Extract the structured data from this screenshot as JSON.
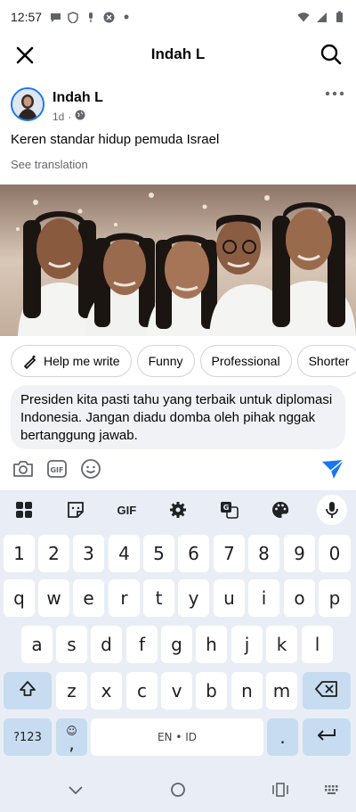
{
  "status": {
    "time": "12:57"
  },
  "header": {
    "title": "Indah L"
  },
  "post": {
    "author": "Indah L",
    "age": "1d",
    "text": "Keren standar hidup pemuda Israel",
    "see_translation": "See translation"
  },
  "suggestions": [
    "Help me write",
    "Funny",
    "Professional",
    "Shorter"
  ],
  "comment": {
    "value": "Presiden kita pasti tahu yang terbaik untuk diplomasi Indonesia. Jangan diadu domba oleh pihak nggak bertanggung jawab."
  },
  "keyboard": {
    "toolbar": {
      "gif_label": "GIF"
    },
    "row_numbers": [
      "1",
      "2",
      "3",
      "4",
      "5",
      "6",
      "7",
      "8",
      "9",
      "0"
    ],
    "row1": [
      "q",
      "w",
      "e",
      "r",
      "t",
      "y",
      "u",
      "i",
      "o",
      "p"
    ],
    "row2": [
      "a",
      "s",
      "d",
      "f",
      "g",
      "h",
      "j",
      "k",
      "l"
    ],
    "row3": [
      "z",
      "x",
      "c",
      "v",
      "b",
      "n",
      "m"
    ],
    "symbols_label": "?123",
    "comma": ",",
    "space_label": "EN • ID",
    "period": "."
  },
  "colors": {
    "accent": "#1877f2",
    "keyboard_bg": "#e9eef6",
    "key_alt": "#c7dcf0"
  },
  "icons": [
    "close-icon",
    "search-icon",
    "more-icon",
    "globe-icon",
    "wand-icon",
    "camera-icon",
    "gif-icon",
    "emoji-icon",
    "send-icon",
    "mic-icon",
    "backspace-icon",
    "shift-icon",
    "enter-icon"
  ]
}
